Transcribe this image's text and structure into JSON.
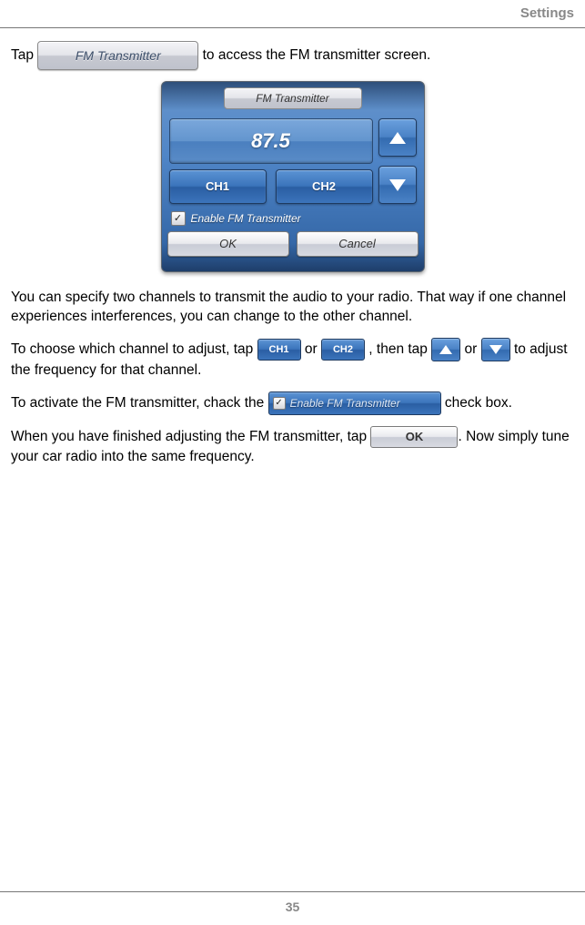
{
  "header": {
    "title": "Settings"
  },
  "intro": {
    "tap": "Tap",
    "fmt_button": "FM Transmitter",
    "rest": " to access the FM transmitter screen."
  },
  "screenshot": {
    "title": "FM Transmitter",
    "frequency": "87.5",
    "ch1": "CH1",
    "ch2": "CH2",
    "checkbox_label": "Enable FM Transmitter",
    "checkbox_mark": "✓",
    "ok": "OK",
    "cancel": "Cancel"
  },
  "para2": "You can specify two channels to transmit the audio to your radio. That way if one channel experiences interferences, you can change to the other channel.",
  "para3": {
    "a": "To choose which channel to adjust, tap ",
    "ch1": "CH1",
    "b": " or ",
    "ch2": "CH2",
    "c": ", then tap ",
    "d": " or ",
    "e": " to adjust the frequency for that channel."
  },
  "para4": {
    "a": "To activate the FM transmitter, chack the ",
    "enable_label": "Enable FM Transmitter",
    "check_mark": "✓",
    "b": " check box."
  },
  "para5": {
    "a": "When you have finished adjusting the FM transmitter, tap ",
    "ok": "OK",
    "b": ". Now simply tune your car radio into the same frequency."
  },
  "footer": {
    "page": "35"
  }
}
